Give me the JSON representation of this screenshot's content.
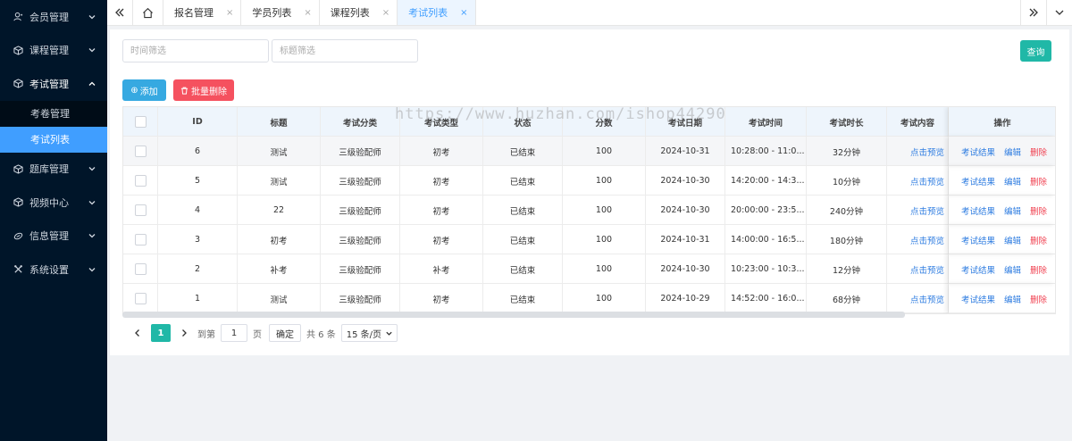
{
  "sidebar": {
    "items": [
      {
        "label": "会员管理",
        "icon": "user-icon"
      },
      {
        "label": "课程管理",
        "icon": "cube-icon"
      },
      {
        "label": "考试管理",
        "icon": "cube-icon",
        "open": true
      },
      {
        "label": "题库管理",
        "icon": "cube-icon"
      },
      {
        "label": "视频中心",
        "icon": "cube-icon"
      },
      {
        "label": "信息管理",
        "icon": "link-icon"
      },
      {
        "label": "系统设置",
        "icon": "tools-icon"
      }
    ],
    "sub_items": [
      {
        "label": "考卷管理"
      },
      {
        "label": "考试列表",
        "active": true
      }
    ]
  },
  "tabs": [
    {
      "label": "报名管理"
    },
    {
      "label": "学员列表"
    },
    {
      "label": "课程列表"
    },
    {
      "label": "考试列表",
      "active": true
    }
  ],
  "tab_close": "×",
  "filters": {
    "time_placeholder": "时间筛选",
    "title_placeholder": "标题筛选",
    "query_label": "查询"
  },
  "actions": {
    "add_label": "添加",
    "batch_delete_label": "批量删除"
  },
  "table": {
    "headers": [
      "ID",
      "标题",
      "考试分类",
      "考试类型",
      "状态",
      "分数",
      "考试日期",
      "考试时间",
      "考试时长",
      "考试内容",
      "操作"
    ],
    "rows": [
      {
        "id": "6",
        "title": "测试",
        "category": "三级验配师",
        "type": "初考",
        "status": "已结束",
        "score": "100",
        "date": "2024-10-31",
        "time": "10:28:00 - 11:0...",
        "duration": "32分钟",
        "content": "点击预览"
      },
      {
        "id": "5",
        "title": "测试",
        "category": "三级验配师",
        "type": "初考",
        "status": "已结束",
        "score": "100",
        "date": "2024-10-30",
        "time": "14:20:00 - 14:3...",
        "duration": "10分钟",
        "content": "点击预览"
      },
      {
        "id": "4",
        "title": "22",
        "category": "三级验配师",
        "type": "初考",
        "status": "已结束",
        "score": "100",
        "date": "2024-10-30",
        "time": "20:00:00 - 23:5...",
        "duration": "240分钟",
        "content": "点击预览"
      },
      {
        "id": "3",
        "title": "初考",
        "category": "三级验配师",
        "type": "初考",
        "status": "已结束",
        "score": "100",
        "date": "2024-10-31",
        "time": "14:00:00 - 16:5...",
        "duration": "180分钟",
        "content": "点击预览"
      },
      {
        "id": "2",
        "title": "补考",
        "category": "三级验配师",
        "type": "补考",
        "status": "已结束",
        "score": "100",
        "date": "2024-10-30",
        "time": "10:23:00 - 10:3...",
        "duration": "12分钟",
        "content": "点击预览"
      },
      {
        "id": "1",
        "title": "测试",
        "category": "三级验配师",
        "type": "初考",
        "status": "已结束",
        "score": "100",
        "date": "2024-10-29",
        "time": "14:52:00 - 16:0...",
        "duration": "68分钟",
        "content": "点击预览"
      }
    ],
    "op_labels": {
      "result": "考试结果",
      "edit": "编辑",
      "delete": "删除"
    }
  },
  "pagination": {
    "current": "1",
    "goto_label": "到第",
    "page_value": "1",
    "page_label": "页",
    "confirm_label": "确定",
    "total_label": "共 6 条",
    "page_size": "15 条/页"
  },
  "watermark": "https://www.huzhan.com/ishop44290",
  "colors": {
    "sidebar_bg": "#001529",
    "active_blue": "#409eff",
    "teal": "#20b8a7",
    "danger": "#f5515f",
    "add": "#36a9e1"
  }
}
